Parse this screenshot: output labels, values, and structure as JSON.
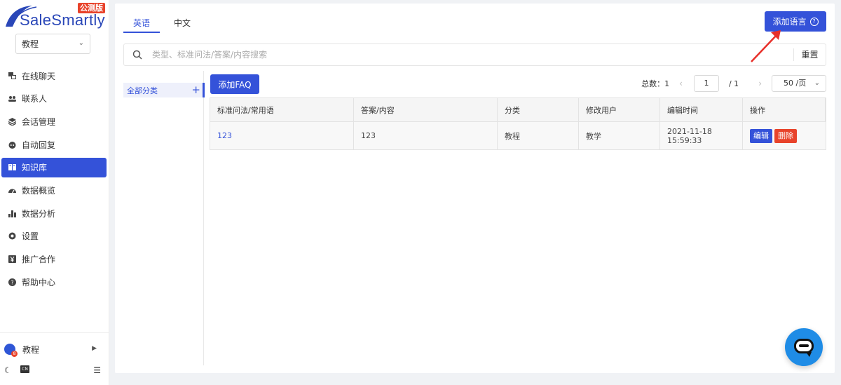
{
  "brand": {
    "name": "SaleSmartly",
    "badge": "公测版"
  },
  "workspace": {
    "selected": "教程"
  },
  "sidebar": {
    "items": [
      {
        "label": "在线聊天",
        "icon": "chat-icon"
      },
      {
        "label": "联系人",
        "icon": "contacts-icon"
      },
      {
        "label": "会话管理",
        "icon": "layers-icon"
      },
      {
        "label": "自动回复",
        "icon": "robot-icon"
      },
      {
        "label": "知识库",
        "icon": "book-icon",
        "active": true
      },
      {
        "label": "数据概览",
        "icon": "dashboard-icon"
      },
      {
        "label": "数据分析",
        "icon": "bar-chart-icon"
      },
      {
        "label": "设置",
        "icon": "gear-icon"
      },
      {
        "label": "推广合作",
        "icon": "yen-icon"
      },
      {
        "label": "帮助中心",
        "icon": "help-icon"
      }
    ],
    "user": {
      "name": "教程",
      "badge": "8"
    },
    "lang_badge": "CN"
  },
  "tabs": [
    {
      "label": "英语",
      "active": true
    },
    {
      "label": "中文",
      "active": false
    }
  ],
  "header": {
    "add_language": "添加语言"
  },
  "search": {
    "placeholder": "类型、标准问法/答案/内容搜索",
    "value": "",
    "reset": "重置"
  },
  "categories": {
    "items": [
      {
        "label": "全部分类"
      }
    ]
  },
  "toolbar": {
    "add_faq": "添加FAQ"
  },
  "pagination": {
    "total_label": "总数：1",
    "current_page": "1",
    "total_pages": "/ 1",
    "page_size": "50 /页"
  },
  "table": {
    "columns": [
      "标准问法/常用语",
      "答案/内容",
      "分类",
      "修改用户",
      "编辑时间",
      "操作"
    ],
    "rows": [
      {
        "question": "123",
        "answer": "123",
        "category": "教程",
        "user": "教学",
        "time": "2021-11-18 15:59:33",
        "edit": "编辑",
        "delete": "删除"
      }
    ]
  },
  "colors": {
    "primary": "#3452d9",
    "danger": "#e8432b",
    "chat_fab": "#1f8ce6",
    "annotation_arrow": "#e8302a"
  }
}
